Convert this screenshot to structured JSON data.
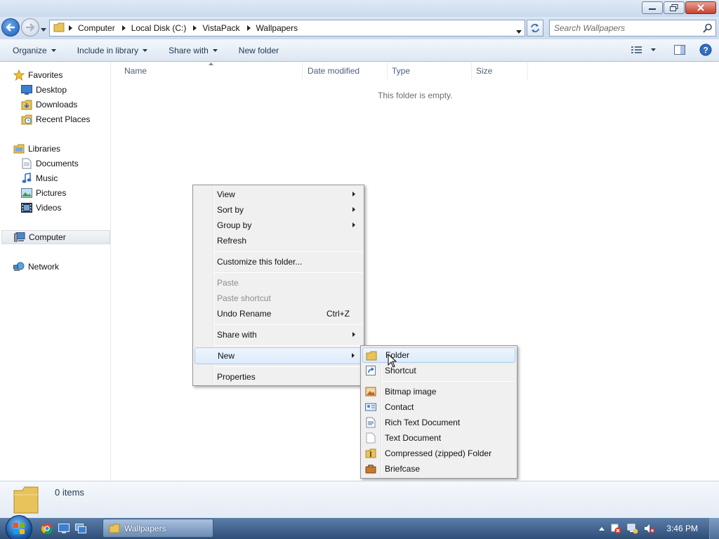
{
  "address": {
    "crumbs": [
      "Computer",
      "Local Disk (C:)",
      "VistaPack",
      "Wallpapers"
    ]
  },
  "search": {
    "placeholder": "Search Wallpapers"
  },
  "toolbar": {
    "organize": "Organize",
    "include_in_library": "Include in library",
    "share_with": "Share with",
    "new_folder": "New folder"
  },
  "nav": {
    "favorites": "Favorites",
    "desktop": "Desktop",
    "downloads": "Downloads",
    "recent_places": "Recent Places",
    "libraries": "Libraries",
    "documents": "Documents",
    "music": "Music",
    "pictures": "Pictures",
    "videos": "Videos",
    "computer": "Computer",
    "network": "Network"
  },
  "columns": {
    "name": "Name",
    "date_modified": "Date modified",
    "type": "Type",
    "size": "Size"
  },
  "empty_message": "This folder is empty.",
  "context_menu": {
    "view": "View",
    "sort_by": "Sort by",
    "group_by": "Group by",
    "refresh": "Refresh",
    "customize": "Customize this folder...",
    "paste": "Paste",
    "paste_shortcut": "Paste shortcut",
    "undo_rename": "Undo Rename",
    "undo_shortcut": "Ctrl+Z",
    "share_with": "Share with",
    "new": "New",
    "properties": "Properties"
  },
  "new_submenu": {
    "folder": "Folder",
    "shortcut": "Shortcut",
    "bitmap": "Bitmap image",
    "contact": "Contact",
    "rich_text": "Rich Text Document",
    "text": "Text Document",
    "zipped": "Compressed (zipped) Folder",
    "briefcase": "Briefcase"
  },
  "details": {
    "count": "0 items"
  },
  "taskbar": {
    "window_label": "Wallpapers",
    "clock": "3:46 PM"
  }
}
